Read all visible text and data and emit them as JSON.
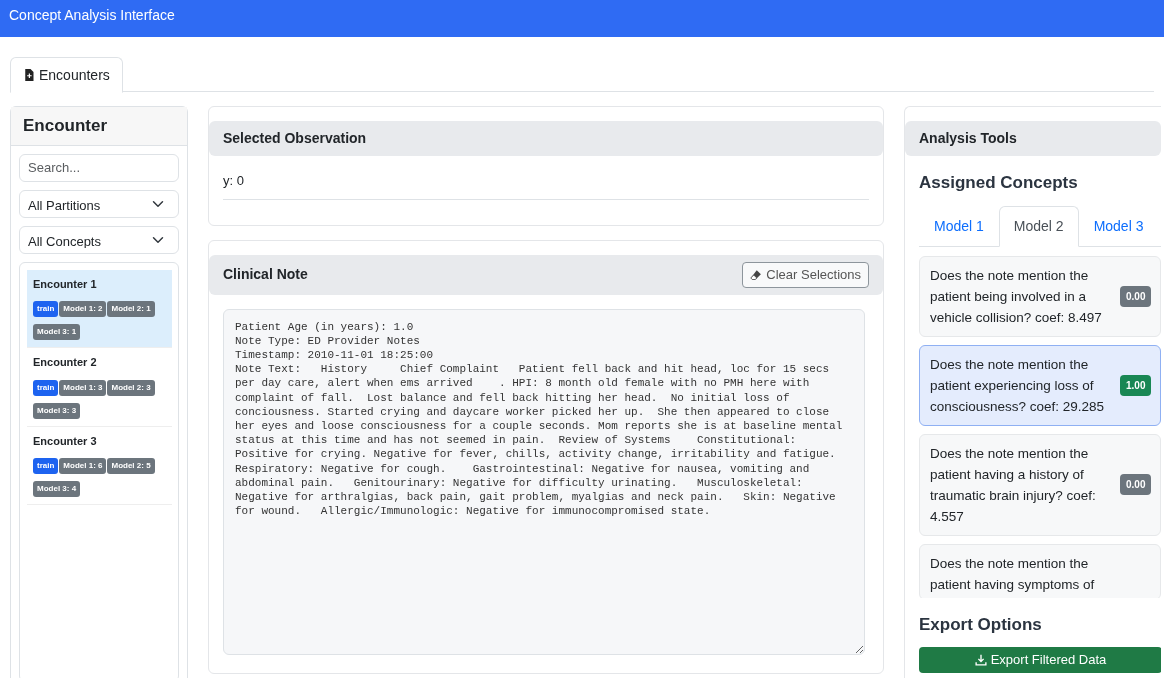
{
  "navbar": {
    "title": "Concept Analysis Interface"
  },
  "tabs": [
    {
      "label": "Encounters",
      "selected": true
    }
  ],
  "sidebar": {
    "title": "Encounter",
    "search": {
      "placeholder": "Search..."
    },
    "filters": [
      {
        "value": "All Partitions"
      },
      {
        "value": "All Concepts"
      }
    ],
    "encounters": [
      {
        "name": "Encounter 1",
        "selected": true,
        "tags": [
          {
            "text": "train",
            "kind": "partition"
          },
          {
            "text": "Model 1: 2",
            "kind": "model"
          },
          {
            "text": "Model 2: 1",
            "kind": "model"
          },
          {
            "text": "Model 3: 1",
            "kind": "model"
          }
        ]
      },
      {
        "name": "Encounter 2",
        "selected": false,
        "tags": [
          {
            "text": "train",
            "kind": "partition"
          },
          {
            "text": "Model 1: 3",
            "kind": "model"
          },
          {
            "text": "Model 2: 3",
            "kind": "model"
          },
          {
            "text": "Model 3: 3",
            "kind": "model"
          }
        ]
      },
      {
        "name": "Encounter 3",
        "selected": false,
        "tags": [
          {
            "text": "train",
            "kind": "partition"
          },
          {
            "text": "Model 1: 6",
            "kind": "model"
          },
          {
            "text": "Model 2: 5",
            "kind": "model"
          },
          {
            "text": "Model 3: 4",
            "kind": "model"
          }
        ]
      }
    ]
  },
  "observation": {
    "title": "Selected Observation",
    "label": "y:",
    "value": "0"
  },
  "clinical_note": {
    "title": "Clinical Note",
    "clear_button": "Clear Selections",
    "text": "Patient Age (in years): 1.0\nNote Type: ED Provider Notes\nTimestamp: 2010-11-01 18:25:00\nNote Text:   History     Chief Complaint   Patient fell back and hit head, loc for 15 secs per day care, alert when ems arrived    . HPI: 8 month old female with no PMH here with complaint of fall.  Lost balance and fell back hitting her head.  No initial loss of conciousness. Started crying and daycare worker picked her up.  She then appeared to close her eyes and loose consciousness for a couple seconds. Mom reports she is at baseline mental status at this time and has not seemed in pain.  Review of Systems    Constitutional: Positive for crying. Negative for fever, chills, activity change, irritability and fatigue. Respiratory: Negative for cough.    Gastrointestinal: Negative for nausea, vomiting and abdominal pain.   Genitourinary: Negative for difficulty urinating.   Musculoskeletal: Negative for arthralgias, back pain, gait problem, myalgias and neck pain.   Skin: Negative for wound.   Allergic/Immunologic: Negative for immunocompromised state."
  },
  "analysis": {
    "title": "Analysis Tools",
    "concepts_heading": "Assigned Concepts",
    "model_tabs": [
      {
        "label": "Model 1",
        "selected": false
      },
      {
        "label": "Model 2",
        "selected": true
      },
      {
        "label": "Model 3",
        "selected": false
      }
    ],
    "concepts": [
      {
        "text": "Does the note mention the patient being involved in a vehicle collision? coef: 8.497",
        "score": "0.00",
        "color": "#6c757d",
        "selected": false
      },
      {
        "text": "Does the note mention the patient experiencing loss of consciousness? coef: 29.285",
        "score": "1.00",
        "color": "#198754",
        "selected": true
      },
      {
        "text": "Does the note mention the patient having a history of traumatic brain injury? coef: 4.557",
        "score": "0.00",
        "color": "#6c757d",
        "selected": false
      },
      {
        "text": "Does the note mention the patient having symptoms of",
        "selected": false
      }
    ],
    "export_heading": "Export Options",
    "export_button": "Export Filtered Data"
  }
}
